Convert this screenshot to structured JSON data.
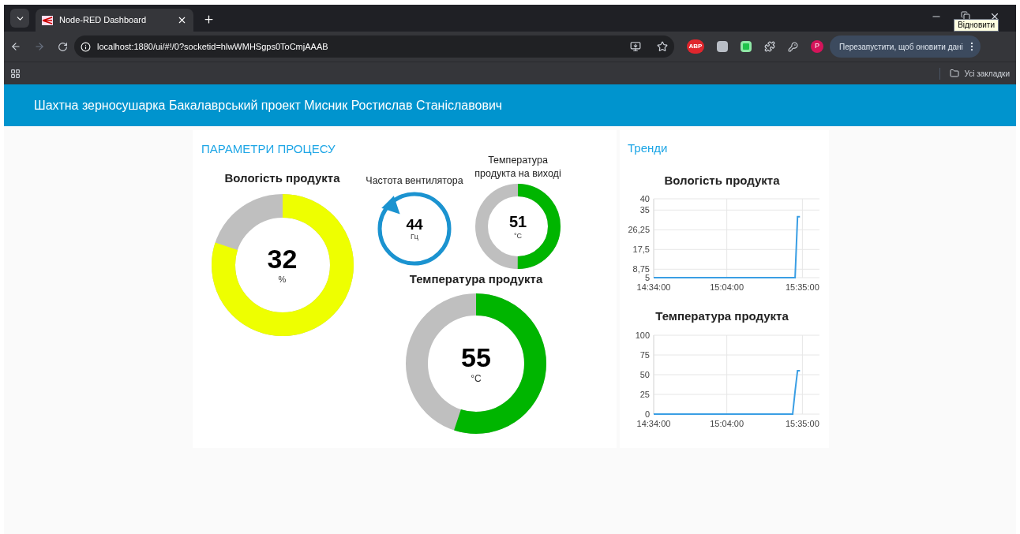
{
  "browser": {
    "tabs": [
      {
        "title": "Node-RED Dashboard",
        "selected": true
      }
    ],
    "address": "localhost:1880/ui/#!/0?socketid=hlwWMHSgps0ToCmjAAAB",
    "adblock_badge": "ABP",
    "profile_initial": "P",
    "update_button": "Перезапустити, щоб оновити дані",
    "tooltip": "Відновити",
    "bookmarks_folder": "Усі закладки"
  },
  "header": {
    "title": "Шахтна зерносушарка Бакалаврський проект Мисник Ростислав Станіславович"
  },
  "parameters": {
    "title": "ПАРАМЕТРИ ПРОЦЕСУ",
    "gauges": [
      {
        "kind": "donut",
        "label": "Вологість продукта",
        "value": "32",
        "unit": "%",
        "level": 0.8,
        "color": "#eeff00"
      },
      {
        "kind": "compass",
        "label": "Частота вентилятора",
        "value": "44",
        "unit": "Гц",
        "color": "#1b93d0"
      },
      {
        "kind": "donut",
        "label": "Температура продукта на виході",
        "value": "51",
        "unit": "°C",
        "level": 0.5,
        "color": "#00b500"
      },
      {
        "kind": "donut",
        "label": "Температура продукта",
        "value": "55",
        "unit": "°C",
        "level": 0.55,
        "color": "#00b500"
      }
    ]
  },
  "trends": {
    "title": "Тренди",
    "charts": [
      {
        "chart_data": {
          "type": "line",
          "grid": true,
          "title": "Вологість продукта",
          "categories": [
            "14:34:00",
            null,
            null,
            null,
            null,
            null,
            null,
            null,
            null,
            null,
            null,
            null,
            null,
            null,
            null,
            null,
            null,
            null,
            null,
            null,
            null,
            null,
            null,
            null,
            null,
            null,
            null,
            null,
            null,
            null,
            "15:04:00",
            null,
            null,
            null,
            null,
            null,
            null,
            null,
            null,
            null,
            null,
            null,
            null,
            null,
            null,
            null,
            null,
            null,
            null,
            null,
            null,
            null,
            null,
            null,
            null,
            null,
            null,
            null,
            null,
            null,
            null,
            "15:35:00",
            null,
            null,
            null,
            null,
            null,
            null,
            null
          ],
          "series": [
            {
              "color": "#3a9ee4",
              "values": [
                5,
                5,
                5,
                5,
                5,
                5,
                5,
                5,
                5,
                5,
                5,
                5,
                5,
                5,
                5,
                5,
                5,
                5,
                5,
                5,
                5,
                5,
                5,
                5,
                5,
                5,
                5,
                5,
                5,
                5,
                5,
                5,
                5,
                5,
                5,
                5,
                5,
                5,
                5,
                5,
                5,
                5,
                5,
                5,
                5,
                5,
                5,
                5,
                5,
                5,
                5,
                5,
                5,
                5,
                5,
                5,
                5,
                5,
                5,
                32,
                32,
                null,
                null,
                null,
                null,
                null,
                null,
                null,
                null
              ]
            }
          ],
          "ylim": [
            5,
            40
          ],
          "yticks": [
            {
              "value": 5,
              "label": "5"
            },
            {
              "value": 8.75,
              "label": "8,75"
            },
            {
              "value": 17.5,
              "label": "17,5"
            },
            {
              "value": 26.25,
              "label": "26,25"
            },
            {
              "value": 35,
              "label": "35"
            },
            {
              "value": 40,
              "label": "40"
            }
          ]
        }
      },
      {
        "chart_data": {
          "type": "line",
          "grid": true,
          "title": "Температура продукта",
          "categories": [
            "14:34:00",
            null,
            null,
            null,
            null,
            null,
            null,
            null,
            null,
            null,
            null,
            null,
            null,
            null,
            null,
            null,
            null,
            null,
            null,
            null,
            null,
            null,
            null,
            null,
            null,
            null,
            null,
            null,
            null,
            null,
            "15:04:00",
            null,
            null,
            null,
            null,
            null,
            null,
            null,
            null,
            null,
            null,
            null,
            null,
            null,
            null,
            null,
            null,
            null,
            null,
            null,
            null,
            null,
            null,
            null,
            null,
            null,
            null,
            null,
            null,
            null,
            null,
            "15:35:00",
            null,
            null,
            null,
            null,
            null,
            null,
            null
          ],
          "series": [
            {
              "color": "#3a9ee4",
              "values": [
                0,
                0,
                0,
                0,
                0,
                0,
                0,
                0,
                0,
                0,
                0,
                0,
                0,
                0,
                0,
                0,
                0,
                0,
                0,
                0,
                0,
                0,
                0,
                0,
                0,
                0,
                0,
                0,
                0,
                0,
                0,
                0,
                0,
                0,
                0,
                0,
                0,
                0,
                0,
                0,
                0,
                0,
                0,
                0,
                0,
                0,
                0,
                0,
                0,
                0,
                0,
                0,
                0,
                0,
                0,
                0,
                0,
                0,
                29,
                55,
                55,
                null,
                null,
                null,
                null,
                null,
                null,
                null,
                null
              ]
            }
          ],
          "ylim": [
            0,
            100
          ],
          "yticks": [
            {
              "value": 0,
              "label": "0"
            },
            {
              "value": 25,
              "label": "25"
            },
            {
              "value": 50,
              "label": "50"
            },
            {
              "value": 75,
              "label": "75"
            },
            {
              "value": 100,
              "label": "100"
            }
          ]
        }
      }
    ]
  }
}
